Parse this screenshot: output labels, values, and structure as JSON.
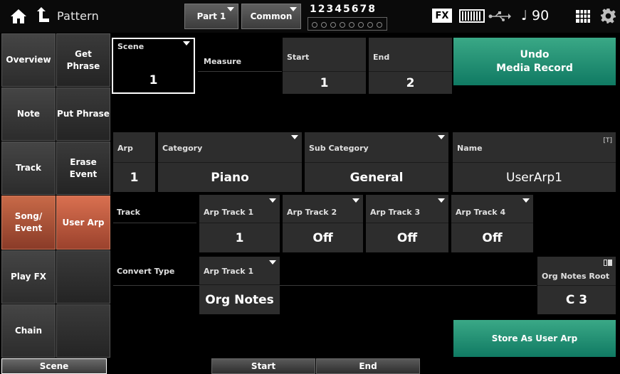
{
  "header": {
    "title": "Pattern",
    "part_label": "Part 1",
    "common_label": "Common",
    "parts_numbers": "12345678",
    "fx_label": "FX",
    "tempo": "♩ 90"
  },
  "left_tabs": {
    "col1": [
      "Overview",
      "Note",
      "Track",
      "Song/\nEvent",
      "Play FX",
      "Chain"
    ],
    "col2": [
      "Get Phrase",
      "Put Phrase",
      "Erase\nEvent",
      "User Arp",
      "",
      ""
    ],
    "active_col1": "Song/\nEvent",
    "active_col2": "User Arp"
  },
  "scene": {
    "label": "Scene",
    "value": "1"
  },
  "measure": {
    "label": "Measure"
  },
  "start": {
    "label": "Start",
    "value": "1"
  },
  "end": {
    "label": "End",
    "value": "2"
  },
  "undo_button": {
    "line1": "Undo",
    "line2": "Media Record"
  },
  "arp": {
    "arp_label": "Arp",
    "arp_value": "1",
    "category_label": "Category",
    "category_value": "Piano",
    "subcategory_label": "Sub Category",
    "subcategory_value": "General",
    "name_label": "Name",
    "name_value": "UserArp1",
    "name_icon": "[T]"
  },
  "track": {
    "label": "Track",
    "items": [
      {
        "label": "Arp Track 1",
        "value": "1"
      },
      {
        "label": "Arp Track 2",
        "value": "Off"
      },
      {
        "label": "Arp Track 3",
        "value": "Off"
      },
      {
        "label": "Arp Track 4",
        "value": "Off"
      }
    ]
  },
  "convert": {
    "label": "Convert Type",
    "track_label": "Arp Track 1",
    "track_value": "Org Notes",
    "root_label": "Org Notes Root",
    "root_value": "C 3"
  },
  "store_button": {
    "label": "Store As User Arp"
  },
  "bottom": {
    "scene": "Scene",
    "start": "Start",
    "end": "End"
  },
  "colors": {
    "accent_green": "#1f8c70",
    "active_tab": "#b0553a",
    "cell_bg": "#2d2d2d"
  }
}
